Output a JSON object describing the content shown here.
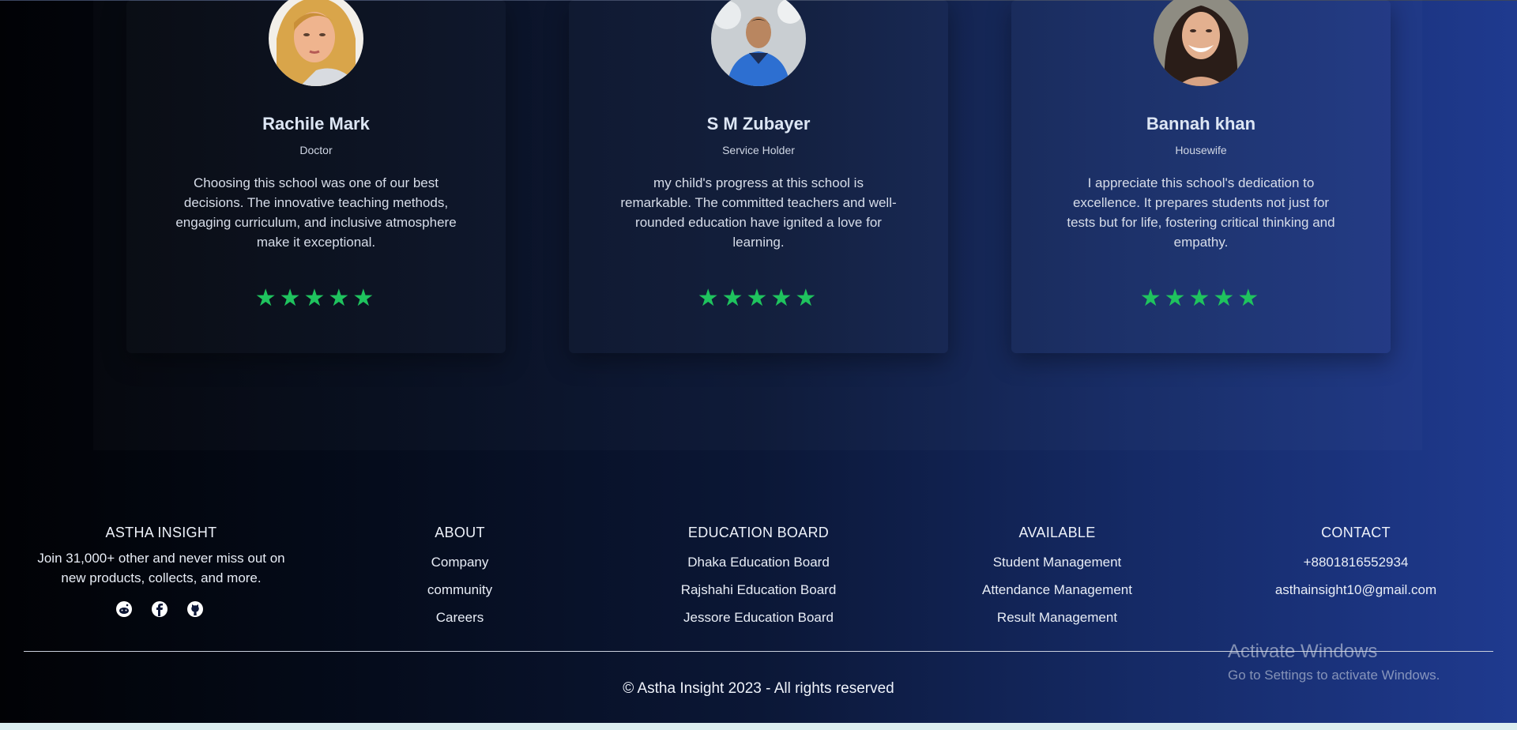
{
  "testimonials": [
    {
      "name": "Rachile Mark",
      "role": "Doctor",
      "text": "Choosing this school was one of our best decisions. The innovative teaching methods, engaging curriculum, and inclusive atmosphere make it exceptional.",
      "stars": "★★★★★",
      "rating": 5
    },
    {
      "name": "S M Zubayer",
      "role": "Service Holder",
      "text": "my child's progress at this school is remarkable. The committed teachers and well-rounded education have ignited a love for learning.",
      "stars": "★★★★★",
      "rating": 5
    },
    {
      "name": "Bannah khan",
      "role": "Housewife",
      "text": "I appreciate this school's dedication to excellence. It prepares students not just for tests but for life, fostering critical thinking and empathy.",
      "stars": "★★★★★",
      "rating": 5
    }
  ],
  "footer": {
    "brand": {
      "heading": "ASTHA INSIGHT",
      "tagline": "Join 31,000+ other and never miss out on new products, collects, and more.",
      "socials": [
        "reddit-icon",
        "facebook-icon",
        "github-icon"
      ]
    },
    "about": {
      "heading": "ABOUT",
      "items": [
        "Company",
        "community",
        "Careers"
      ]
    },
    "education_board": {
      "heading": "EDUCATION BOARD",
      "items": [
        "Dhaka Education Board",
        "Rajshahi Education Board",
        "Jessore Education Board"
      ]
    },
    "available": {
      "heading": "AVAILABLE",
      "items": [
        "Student Management",
        "Attendance Management",
        "Result Management"
      ]
    },
    "contact": {
      "heading": "CONTACT",
      "items": [
        "+8801816552934",
        "asthainsight10@gmail.com"
      ]
    },
    "copyright": "© Astha Insight 2023 - All rights reserved"
  },
  "watermark": {
    "title": "Activate Windows",
    "subtitle": "Go to Settings to activate Windows."
  },
  "colors": {
    "star": "#1fc35e",
    "gradient_start": "#010205",
    "gradient_end": "#1f3a8f"
  }
}
